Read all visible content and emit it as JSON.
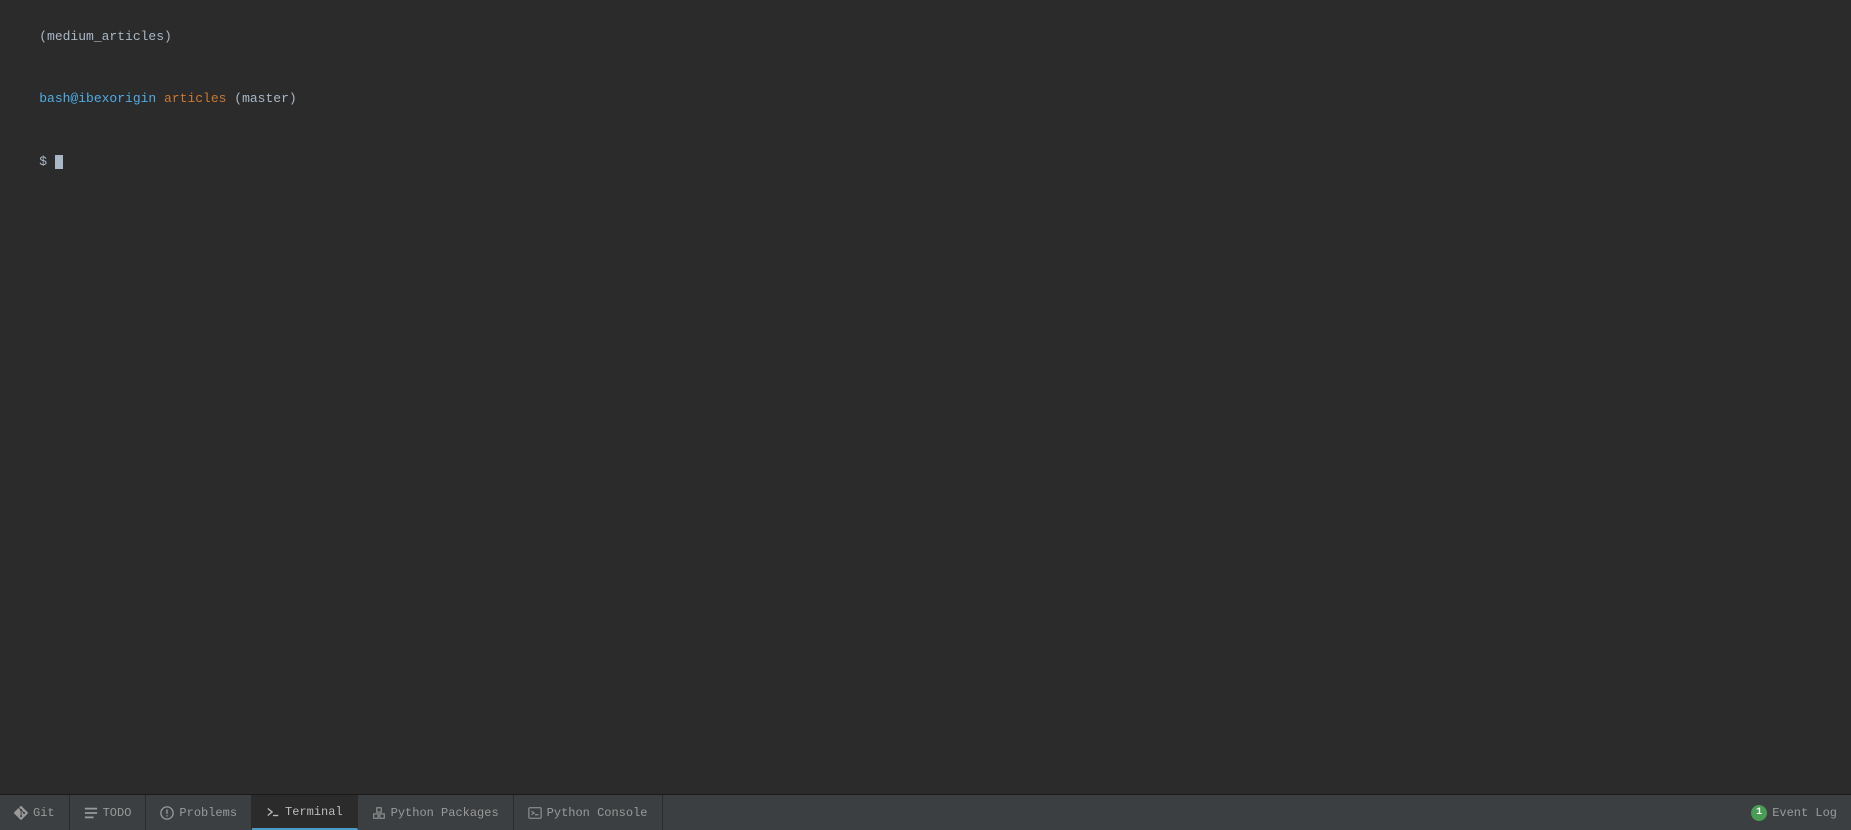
{
  "terminal": {
    "lines": [
      {
        "id": "line1",
        "parts": [
          {
            "text": "(medium_articles)",
            "color": "default"
          }
        ]
      },
      {
        "id": "line2",
        "parts": [
          {
            "text": "bash@ibexorigin",
            "color": "cyan"
          },
          {
            "text": " articles",
            "color": "orange"
          },
          {
            "text": " (master)",
            "color": "default"
          }
        ]
      },
      {
        "id": "line3",
        "parts": [
          {
            "text": "$ ",
            "color": "default"
          }
        ]
      }
    ]
  },
  "bottom_bar": {
    "tabs": [
      {
        "id": "git",
        "label": "Git",
        "icon": "git-icon",
        "active": false
      },
      {
        "id": "todo",
        "label": "TODO",
        "icon": "todo-icon",
        "active": false
      },
      {
        "id": "problems",
        "label": "Problems",
        "icon": "problems-icon",
        "active": false
      },
      {
        "id": "terminal",
        "label": "Terminal",
        "icon": "terminal-icon",
        "active": true
      },
      {
        "id": "python-packages",
        "label": "Python Packages",
        "icon": "packages-icon",
        "active": false
      },
      {
        "id": "python-console",
        "label": "Python Console",
        "icon": "console-icon",
        "active": false
      }
    ],
    "event_log": {
      "label": "Event Log",
      "badge": "1"
    }
  }
}
